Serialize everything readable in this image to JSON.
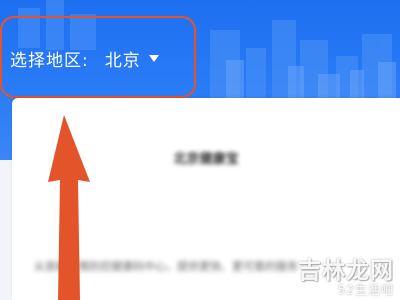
{
  "header": {
    "region_label": "选择地区:",
    "region_value": "北京",
    "caret_icon": "caret-down-icon",
    "background_color": "#2a7bf6"
  },
  "card": {
    "title": "北京健康宝",
    "description": "从首都疫情防控健康码中心，提供更快、更可靠的服务"
  },
  "annotation": {
    "highlight_color": "#e3542b",
    "arrow_color": "#e3542b"
  },
  "watermark": {
    "main": "吉林龙网",
    "sub": "52生活吧"
  }
}
